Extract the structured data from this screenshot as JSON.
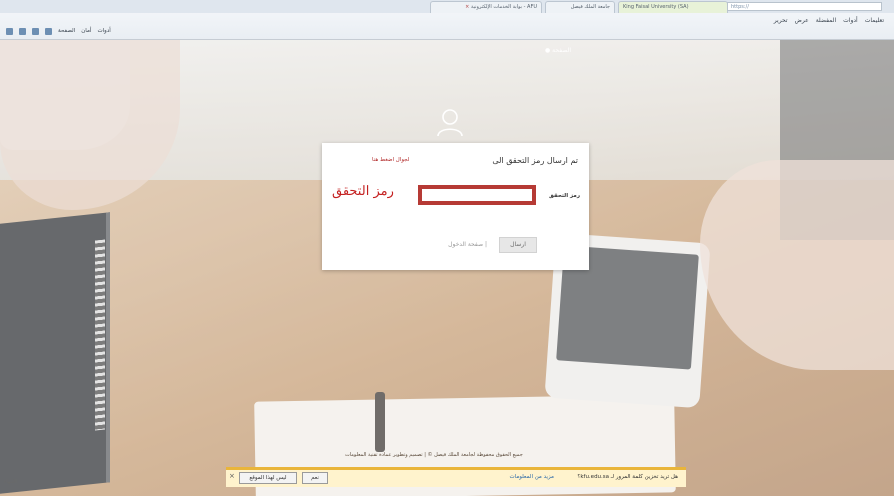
{
  "browser": {
    "tabs": [
      {
        "label": "AFU - بوابة الخدمات الإلكترونية",
        "active": false
      },
      {
        "label": "جامعة الملك فيصل",
        "active": false
      },
      {
        "label": "King Faisal University (SA)",
        "active": true
      }
    ],
    "address": "https://",
    "menu": [
      "تحرير",
      "عرض",
      "المفضلة",
      "أدوات",
      "تعليمات"
    ],
    "commands": [
      "الصفحة",
      "أمان",
      "أدوات"
    ]
  },
  "page": {
    "home_link": "الصفحة"
  },
  "dialog": {
    "title": "تم ارسال رمز التحقق الى",
    "wrong_mobile_link": "لجوال اضغط هنا",
    "code_label": "رمز التحقق",
    "code_value": "",
    "annotation": "رمز التحقق",
    "submit_label": "ارسال",
    "login_page_link": "| صفحة الدخول"
  },
  "footer": {
    "copyright": "جميع الحقوق محفوظة لجامعة الملك فيصل © | تصميم وتطوير عمادة تقنية المعلومات"
  },
  "notification": {
    "question": "هل تريد تخزين كلمة المرور لـ kfu.edu.sa؟",
    "more_info": "مزيد من المعلومات",
    "yes_label": "نعم",
    "no_label": "ليس لهذا الموقع",
    "close": "×"
  },
  "statusbar": {
    "left_text": "الانتهاء"
  },
  "colors": {
    "highlight_red": "#b63a35",
    "annotation_red": "#c41f1f",
    "notif_bg": "#fff3cd"
  }
}
